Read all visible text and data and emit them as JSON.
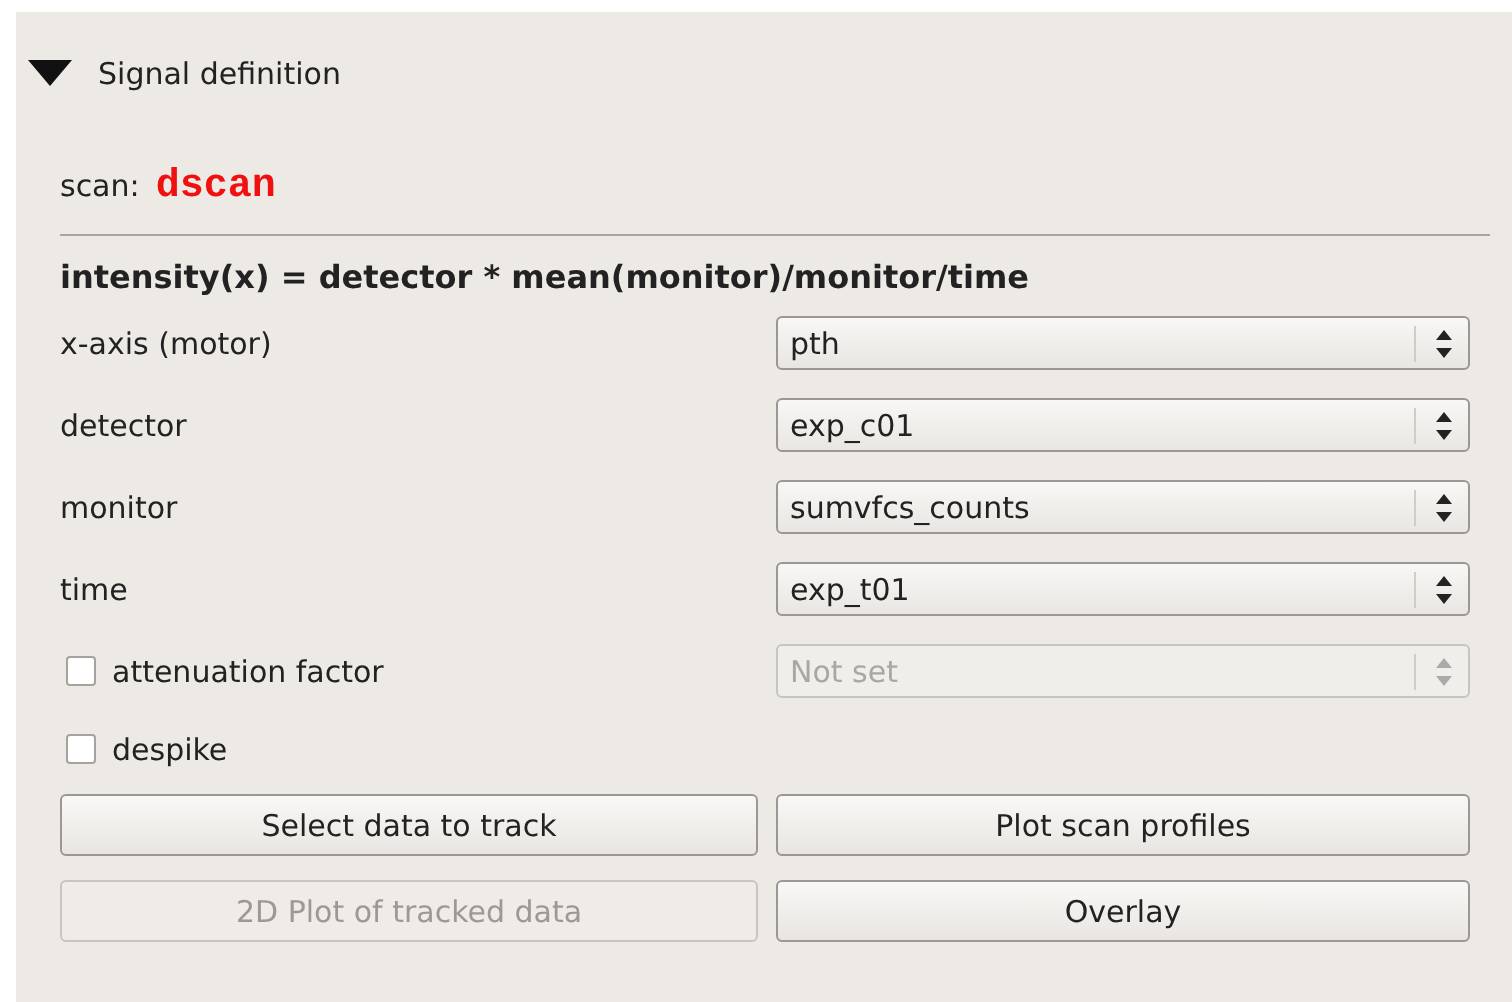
{
  "section": {
    "label": "Signal definition",
    "expanded": true
  },
  "scan": {
    "label": "scan:",
    "value": "dscan"
  },
  "formula": "intensity(x) = detector * mean(monitor)/monitor/time",
  "rows": [
    {
      "kind": "combo",
      "label": "x-axis (motor)",
      "value": "pth",
      "disabled": false
    },
    {
      "kind": "combo",
      "label": "detector",
      "value": "exp_c01",
      "disabled": false
    },
    {
      "kind": "combo",
      "label": "monitor",
      "value": "sumvfcs_counts",
      "disabled": false
    },
    {
      "kind": "combo",
      "label": "time",
      "value": "exp_t01",
      "disabled": false
    },
    {
      "kind": "check_combo",
      "label": "attenuation factor",
      "checked": false,
      "value": "Not set",
      "disabled": true
    },
    {
      "kind": "check",
      "label": "despike",
      "checked": false
    }
  ],
  "buttons": [
    {
      "label": "Select data to track",
      "disabled": false
    },
    {
      "label": "Plot scan profiles",
      "disabled": false
    },
    {
      "label": "2D Plot of tracked data",
      "disabled": true
    },
    {
      "label": "Overlay",
      "disabled": false
    }
  ]
}
